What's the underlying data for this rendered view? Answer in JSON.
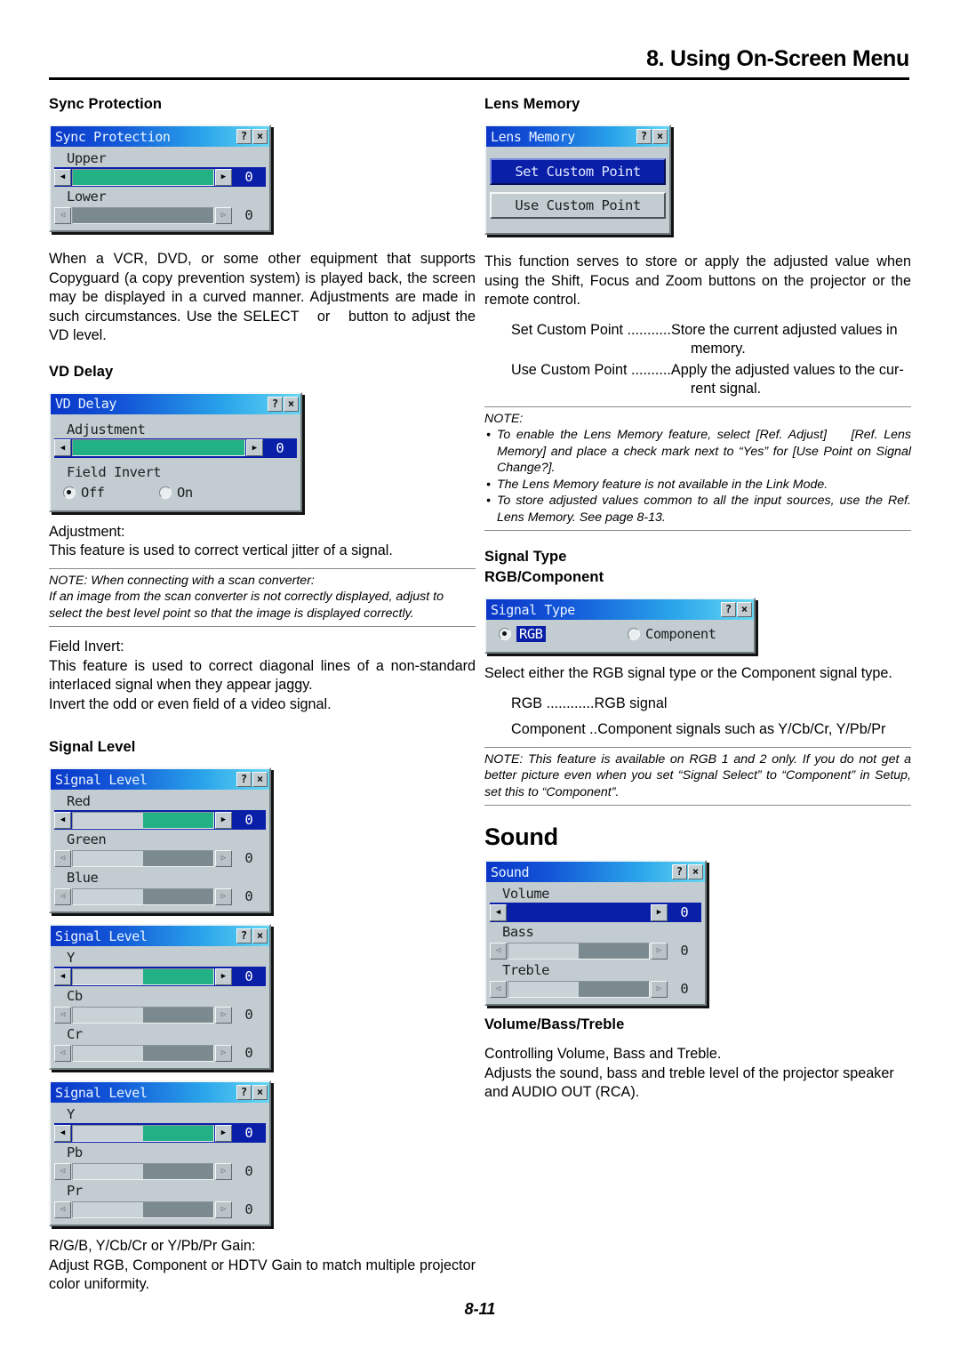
{
  "header": {
    "title": "8. Using On-Screen Menu"
  },
  "page_number": "8-11",
  "left": {
    "sync_protection": {
      "heading": "Sync Protection",
      "dialog": {
        "title": "Sync Protection",
        "help_btn": "?",
        "close_btn": "×",
        "rows": [
          {
            "label": "Upper",
            "value": "0",
            "selected": true,
            "left_arrow": "◀",
            "right_arrow": "▶"
          },
          {
            "label": "Lower",
            "value": "0",
            "selected": false,
            "left_arrow": "◁",
            "right_arrow": "▷"
          }
        ]
      },
      "body": "When a VCR, DVD, or some other equipment that supports Copyguard (a copy prevention system) is played back, the screen may be displayed in a curved manner. Adjustments are made in such circumstances. Use the SELECT   or   button to adjust the VD level."
    },
    "vd_delay": {
      "heading": "VD Delay",
      "dialog": {
        "title": "VD Delay",
        "help_btn": "?",
        "close_btn": "×",
        "slider_label": "Adjustment",
        "slider_value": "0",
        "left_arrow": "◀",
        "right_arrow": "▶",
        "group_label": "Field Invert",
        "option_off": "Off",
        "option_on": "On"
      },
      "adjustment_term": "Adjustment:",
      "adjustment_desc": "This feature is used to correct vertical jitter of a signal.",
      "note_line1": "NOTE: When connecting with a scan converter:",
      "note_line2": "If an image from the scan converter is not correctly displayed, adjust to select the best level point so that the image is displayed correctly.",
      "field_invert_term": "Field Invert:",
      "field_invert_desc1": "This feature is used to correct diagonal lines of a non-standard interlaced signal when they appear jaggy.",
      "field_invert_desc2": "Invert the odd or even field of a video signal."
    },
    "signal_level": {
      "heading": "Signal Level",
      "dialog_rgb": {
        "title": "Signal Level",
        "help_btn": "?",
        "close_btn": "×",
        "rows": [
          {
            "label": "Red",
            "value": "0",
            "selected": true,
            "left_arrow": "◀",
            "right_arrow": "▶"
          },
          {
            "label": "Green",
            "value": "0",
            "selected": false,
            "left_arrow": "◁",
            "right_arrow": "▷"
          },
          {
            "label": "Blue",
            "value": "0",
            "selected": false,
            "left_arrow": "◁",
            "right_arrow": "▷"
          }
        ]
      },
      "dialog_ycbcr": {
        "title": "Signal Level",
        "help_btn": "?",
        "close_btn": "×",
        "rows": [
          {
            "label": "Y",
            "value": "0",
            "selected": true,
            "left_arrow": "◀",
            "right_arrow": "▶"
          },
          {
            "label": "Cb",
            "value": "0",
            "selected": false,
            "left_arrow": "◁",
            "right_arrow": "▷"
          },
          {
            "label": "Cr",
            "value": "0",
            "selected": false,
            "left_arrow": "◁",
            "right_arrow": "▷"
          }
        ]
      },
      "dialog_ypbpr": {
        "title": "Signal Level",
        "help_btn": "?",
        "close_btn": "×",
        "rows": [
          {
            "label": "Y",
            "value": "0",
            "selected": true,
            "left_arrow": "◀",
            "right_arrow": "▶"
          },
          {
            "label": "Pb",
            "value": "0",
            "selected": false,
            "left_arrow": "◁",
            "right_arrow": "▷"
          },
          {
            "label": "Pr",
            "value": "0",
            "selected": false,
            "left_arrow": "◁",
            "right_arrow": "▷"
          }
        ]
      },
      "gain_term": "R/G/B, Y/Cb/Cr or Y/Pb/Pr Gain:",
      "gain_desc": "Adjust RGB, Component or HDTV Gain to match multiple projector color uniformity."
    }
  },
  "right": {
    "lens_memory": {
      "heading": "Lens Memory",
      "dialog": {
        "title": "Lens Memory",
        "help_btn": "?",
        "close_btn": "×",
        "button_set": "Set Custom Point",
        "button_use": "Use Custom Point"
      },
      "body": "This function serves to store or apply the adjusted value when using the Shift, Focus and Zoom buttons on the projector or the remote control.",
      "defs": [
        {
          "term": "Set Custom Point ...........",
          "desc": "Store the current adjusted values in",
          "cont": "memory."
        },
        {
          "term": "Use Custom Point ..........",
          "desc": "Apply the adjusted values to the cur-",
          "cont": "rent signal."
        }
      ],
      "note_title": "NOTE:",
      "note_items": [
        "To enable the Lens Memory feature, select [Ref. Adjust]    [Ref. Lens Memory] and place a check mark next to “Yes” for [Use Point on Signal Change?].",
        "The Lens Memory feature is not available in the Link Mode.",
        "To store adjusted values common to all the input sources, use the Ref. Lens Memory. See page 8-13."
      ]
    },
    "signal_type": {
      "heading": "Signal Type",
      "subheading": "RGB/Component",
      "dialog": {
        "title": "Signal Type",
        "help_btn": "?",
        "close_btn": "×",
        "option_rgb": "RGB",
        "option_component": "Component"
      },
      "body": "Select either the RGB signal type or the Component signal type.",
      "defs": [
        {
          "term": "RGB ............",
          "desc": "RGB signal"
        },
        {
          "term": "Component ..",
          "desc": "Component signals such as Y/Cb/Cr, Y/Pb/Pr"
        }
      ],
      "note": "NOTE: This feature is available on RGB 1 and 2 only. If you do not get a better picture even when you set “Signal Select” to “Component” in Setup, set this to “Component”."
    },
    "sound": {
      "heading": "Sound",
      "dialog": {
        "title": "Sound",
        "help_btn": "?",
        "close_btn": "×",
        "rows": [
          {
            "label": "Volume",
            "value": "0",
            "selected": true,
            "left_arrow": "◀",
            "right_arrow": "▶"
          },
          {
            "label": "Bass",
            "value": "0",
            "selected": false,
            "left_arrow": "◁",
            "right_arrow": "▷"
          },
          {
            "label": "Treble",
            "value": "0",
            "selected": false,
            "left_arrow": "◁",
            "right_arrow": "▷"
          }
        ]
      },
      "subheading": "Volume/Bass/Treble",
      "body1": "Controlling Volume, Bass and Treble.",
      "body2": "Adjusts the sound, bass and treble level of the projector speaker and AUDIO OUT (RCA)."
    }
  }
}
